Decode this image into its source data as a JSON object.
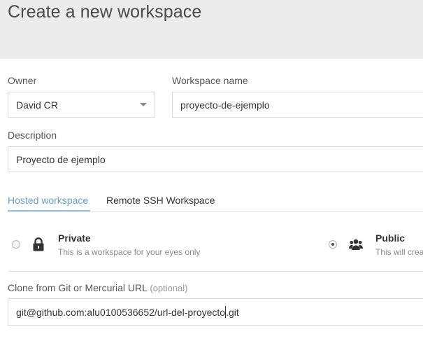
{
  "header": {
    "title": "Create a new workspace"
  },
  "form": {
    "owner": {
      "label": "Owner",
      "value": "David CR"
    },
    "workspace_name": {
      "label": "Workspace name",
      "value": "proyecto-de-ejemplo"
    },
    "description": {
      "label": "Description",
      "value": "Proyecto de ejemplo"
    },
    "tabs": [
      {
        "label": "Hosted workspace",
        "active": true
      },
      {
        "label": "Remote SSH Workspace",
        "active": false
      }
    ],
    "visibility": {
      "options": [
        {
          "title": "Private",
          "description": "This is a workspace for your eyes only",
          "selected": false,
          "icon": "lock-icon"
        },
        {
          "title": "Public",
          "description": "This will crea",
          "selected": true,
          "icon": "users-icon"
        }
      ]
    },
    "clone": {
      "label": "Clone from Git or Mercurial URL",
      "hint": "(optional)",
      "value_before_cursor": "git@github.com:alu0100536652/url-del-proyecto",
      "value_after_cursor": ".git"
    }
  },
  "colors": {
    "header_bg": "#ececec",
    "active_tab": "#6a9fcd",
    "active_tab_underline": "#9dc3e3"
  }
}
